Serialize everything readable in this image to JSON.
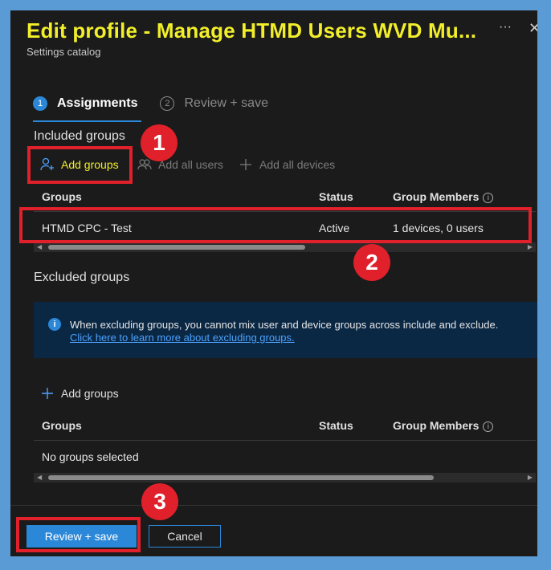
{
  "header": {
    "title": "Edit profile - Manage HTMD Users WVD Mu...",
    "subtitle": "Settings catalog",
    "more_label": "···",
    "close_label": "✕"
  },
  "steps": [
    {
      "number": "1",
      "label": "Assignments",
      "active": true
    },
    {
      "number": "2",
      "label": "Review + save",
      "active": false
    }
  ],
  "included": {
    "label": "Included groups",
    "commands": {
      "add_groups": "Add groups",
      "add_all_users": "Add all users",
      "add_all_devices": "Add all devices"
    },
    "columns": {
      "groups": "Groups",
      "status": "Status",
      "members": "Group Members"
    },
    "rows": [
      {
        "group": "HTMD CPC - Test",
        "status": "Active",
        "members": "1 devices, 0 users"
      }
    ]
  },
  "excluded": {
    "label": "Excluded groups",
    "info_message": "When excluding groups, you cannot mix user and device groups across include and exclude.",
    "info_link": "Click here to learn more about excluding groups.",
    "add_groups": "Add groups",
    "columns": {
      "groups": "Groups",
      "status": "Status",
      "members": "Group Members"
    },
    "empty_text": "No groups selected"
  },
  "footer": {
    "review_save": "Review + save",
    "cancel": "Cancel"
  },
  "annotations": [
    "1",
    "2",
    "3"
  ],
  "colors": {
    "accent": "#2b88d8",
    "title": "#f2ef2a",
    "highlight": "#e0202a",
    "background": "#1b1b1b"
  }
}
